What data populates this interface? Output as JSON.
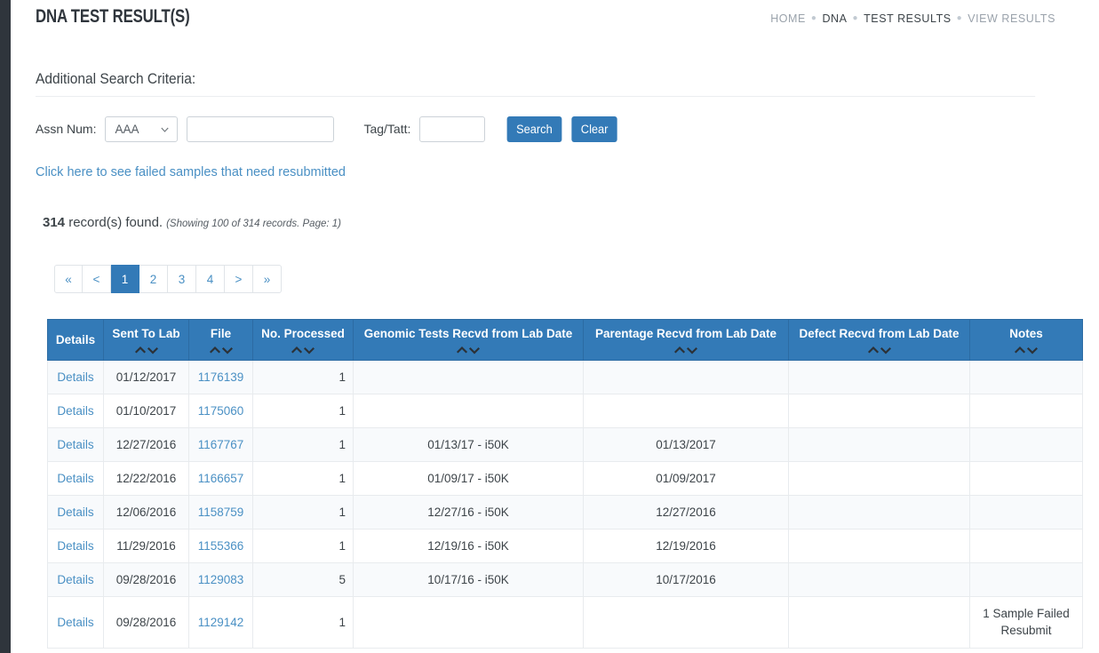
{
  "header": {
    "title": "DNA TEST RESULT(S)",
    "breadcrumb": [
      {
        "label": "HOME",
        "muted": true
      },
      {
        "label": "DNA",
        "muted": false
      },
      {
        "label": "TEST RESULTS",
        "muted": false
      },
      {
        "label": "VIEW RESULTS",
        "muted": true
      }
    ]
  },
  "criteria": {
    "title": "Additional Search Criteria:",
    "assn_label": "Assn Num:",
    "assn_select_value": "AAA",
    "assn_select_options": [
      "AAA"
    ],
    "assn_text_value": "",
    "assn_text_placeholder": "",
    "tag_label": "Tag/Tatt:",
    "tag_value": "",
    "tag_placeholder": "",
    "search_button": "Search",
    "clear_button": "Clear"
  },
  "failed_link": "Click here to see failed samples that need resubmitted",
  "results_summary": {
    "count": "314",
    "found_text": " record(s) found.",
    "showing": "(Showing 100 of 314 records. Page: 1)"
  },
  "pagination": {
    "items": [
      {
        "label": "«",
        "active": false
      },
      {
        "label": "<",
        "active": false
      },
      {
        "label": "1",
        "active": true
      },
      {
        "label": "2",
        "active": false
      },
      {
        "label": "3",
        "active": false
      },
      {
        "label": "4",
        "active": false
      },
      {
        "label": ">",
        "active": false
      },
      {
        "label": "»",
        "active": false
      }
    ]
  },
  "table": {
    "columns": [
      {
        "label": "Details",
        "sortable": false
      },
      {
        "label": "Sent To Lab",
        "sortable": true
      },
      {
        "label": "File",
        "sortable": true
      },
      {
        "label": "No. Processed",
        "sortable": true
      },
      {
        "label": "Genomic Tests Recvd from Lab Date",
        "sortable": true
      },
      {
        "label": "Parentage Recvd from Lab Date",
        "sortable": true
      },
      {
        "label": "Defect Recvd from Lab Date",
        "sortable": true
      },
      {
        "label": "Notes",
        "sortable": true
      }
    ],
    "rows": [
      {
        "details": "Details",
        "sent_to_lab": "01/12/2017",
        "file": "1176139",
        "no_processed": "1",
        "genomic": "",
        "parentage": "",
        "defect": "",
        "notes": ""
      },
      {
        "details": "Details",
        "sent_to_lab": "01/10/2017",
        "file": "1175060",
        "no_processed": "1",
        "genomic": "",
        "parentage": "",
        "defect": "",
        "notes": ""
      },
      {
        "details": "Details",
        "sent_to_lab": "12/27/2016",
        "file": "1167767",
        "no_processed": "1",
        "genomic": "01/13/17 - i50K",
        "parentage": "01/13/2017",
        "defect": "",
        "notes": ""
      },
      {
        "details": "Details",
        "sent_to_lab": "12/22/2016",
        "file": "1166657",
        "no_processed": "1",
        "genomic": "01/09/17 - i50K",
        "parentage": "01/09/2017",
        "defect": "",
        "notes": ""
      },
      {
        "details": "Details",
        "sent_to_lab": "12/06/2016",
        "file": "1158759",
        "no_processed": "1",
        "genomic": "12/27/16 - i50K",
        "parentage": "12/27/2016",
        "defect": "",
        "notes": ""
      },
      {
        "details": "Details",
        "sent_to_lab": "11/29/2016",
        "file": "1155366",
        "no_processed": "1",
        "genomic": "12/19/16 - i50K",
        "parentage": "12/19/2016",
        "defect": "",
        "notes": ""
      },
      {
        "details": "Details",
        "sent_to_lab": "09/28/2016",
        "file": "1129083",
        "no_processed": "5",
        "genomic": "10/17/16 - i50K",
        "parentage": "10/17/2016",
        "defect": "",
        "notes": ""
      },
      {
        "details": "Details",
        "sent_to_lab": "09/28/2016",
        "file": "1129142",
        "no_processed": "1",
        "genomic": "",
        "parentage": "",
        "defect": "",
        "notes": "1 Sample Failed Resubmit"
      }
    ]
  },
  "colors": {
    "primary_blue": "#337ab7",
    "link_blue": "#4a90c4",
    "rail_dark": "#2f353c",
    "alert_red": "#e8403a",
    "row_alt": "#f8fafc"
  }
}
